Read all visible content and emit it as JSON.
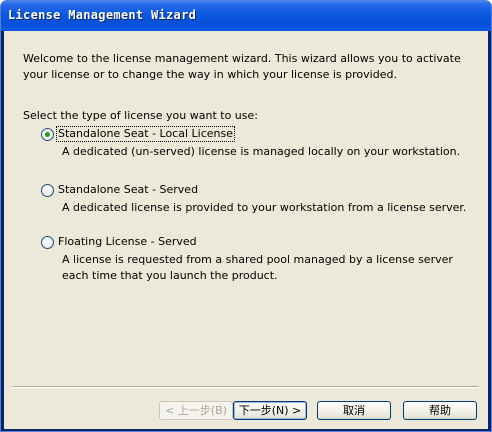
{
  "window": {
    "title": "License Management Wizard"
  },
  "intro": {
    "welcome_text": "Welcome to the license management wizard. This wizard allows you to activate your license or to change the way in which your license is provided.",
    "select_prompt": "Select the type of license you want to use:"
  },
  "license_options": [
    {
      "label": "Standalone Seat - Local License",
      "description": "A dedicated (un-served) license is managed locally on your workstation.",
      "selected": true
    },
    {
      "label": "Standalone Seat - Served",
      "description": "A dedicated license is provided to your workstation from a license server.",
      "selected": false
    },
    {
      "label": "Floating License - Served",
      "description": "A license is requested from a shared pool managed by a license server each time that you launch the product.",
      "selected": false
    }
  ],
  "buttons": {
    "back_label": "< 上一步(B)",
    "next_label": "下一步(N) >",
    "cancel_label": "取消",
    "help_label": "帮助",
    "back_enabled": false
  },
  "colors": {
    "titlebar": "#0a58e0",
    "client_background": "#ece9d8",
    "radio_dot": "#21a121"
  }
}
